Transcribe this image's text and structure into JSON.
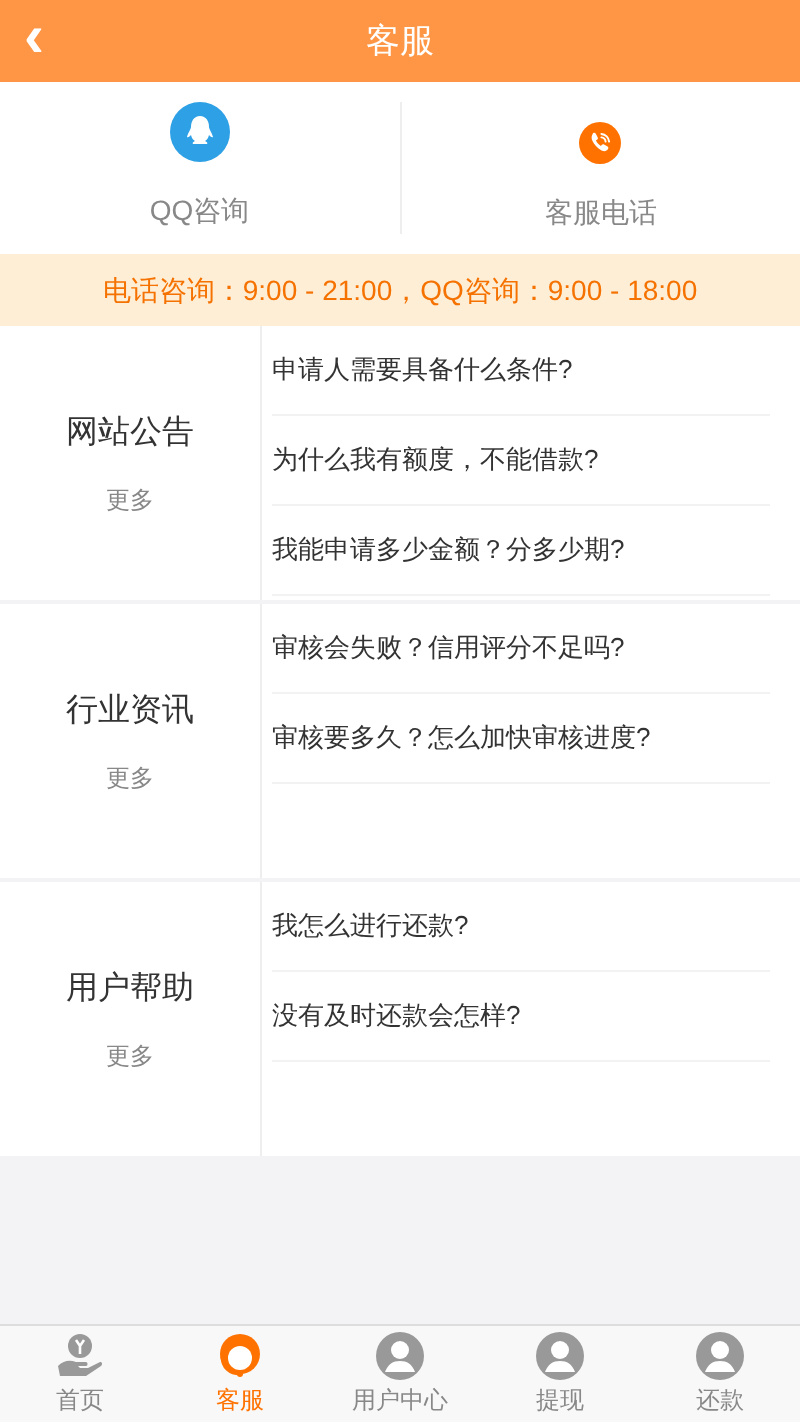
{
  "header": {
    "back": "‹",
    "title": "客服"
  },
  "contacts": [
    {
      "kind": "qq",
      "label": "QQ咨询"
    },
    {
      "kind": "phone",
      "label": "客服电话"
    }
  ],
  "hours": "电话咨询：9:00 - 21:00，QQ咨询：9:00 - 18:00",
  "sections": [
    {
      "title": "网站公告",
      "more": "更多",
      "items": [
        "申请人需要具备什么条件?",
        "为什么我有额度，不能借款?",
        "我能申请多少金额？分多少期?"
      ]
    },
    {
      "title": "行业资讯",
      "more": "更多",
      "items": [
        "审核会失败？信用评分不足吗?",
        "审核要多久？怎么加快审核进度?"
      ]
    },
    {
      "title": "用户帮助",
      "more": "更多",
      "items": [
        "我怎么进行还款?",
        "没有及时还款会怎样?"
      ]
    }
  ],
  "tabbar": [
    {
      "kind": "home",
      "label": "首页",
      "selected": false
    },
    {
      "kind": "service",
      "label": "客服",
      "selected": true
    },
    {
      "kind": "user",
      "label": "用户中心",
      "selected": false
    },
    {
      "kind": "user",
      "label": "提现",
      "selected": false
    },
    {
      "kind": "user",
      "label": "还款",
      "selected": false
    }
  ]
}
